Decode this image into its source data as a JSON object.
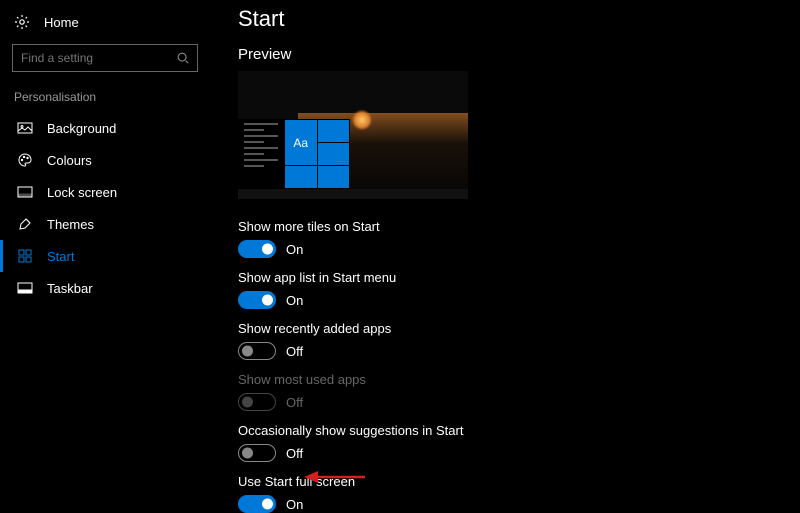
{
  "sidebar": {
    "home_label": "Home",
    "search_placeholder": "Find a setting",
    "section_label": "Personalisation",
    "items": [
      {
        "label": "Background",
        "icon": "picture-icon",
        "selected": false
      },
      {
        "label": "Colours",
        "icon": "palette-icon",
        "selected": false
      },
      {
        "label": "Lock screen",
        "icon": "lockscreen-icon",
        "selected": false
      },
      {
        "label": "Themes",
        "icon": "themes-icon",
        "selected": false
      },
      {
        "label": "Start",
        "icon": "start-icon",
        "selected": true
      },
      {
        "label": "Taskbar",
        "icon": "taskbar-icon",
        "selected": false
      }
    ]
  },
  "main": {
    "title": "Start",
    "preview_label": "Preview",
    "preview_tile_text": "Aa",
    "settings": [
      {
        "label": "Show more tiles on Start",
        "value": true,
        "state_text": "On",
        "disabled": false
      },
      {
        "label": "Show app list in Start menu",
        "value": true,
        "state_text": "On",
        "disabled": false
      },
      {
        "label": "Show recently added apps",
        "value": false,
        "state_text": "Off",
        "disabled": false
      },
      {
        "label": "Show most used apps",
        "value": false,
        "state_text": "Off",
        "disabled": true
      },
      {
        "label": "Occasionally show suggestions in Start",
        "value": false,
        "state_text": "Off",
        "disabled": false
      },
      {
        "label": "Use Start full screen",
        "value": true,
        "state_text": "On",
        "disabled": false
      }
    ]
  },
  "annotation": {
    "arrow_color": "#d02020"
  }
}
